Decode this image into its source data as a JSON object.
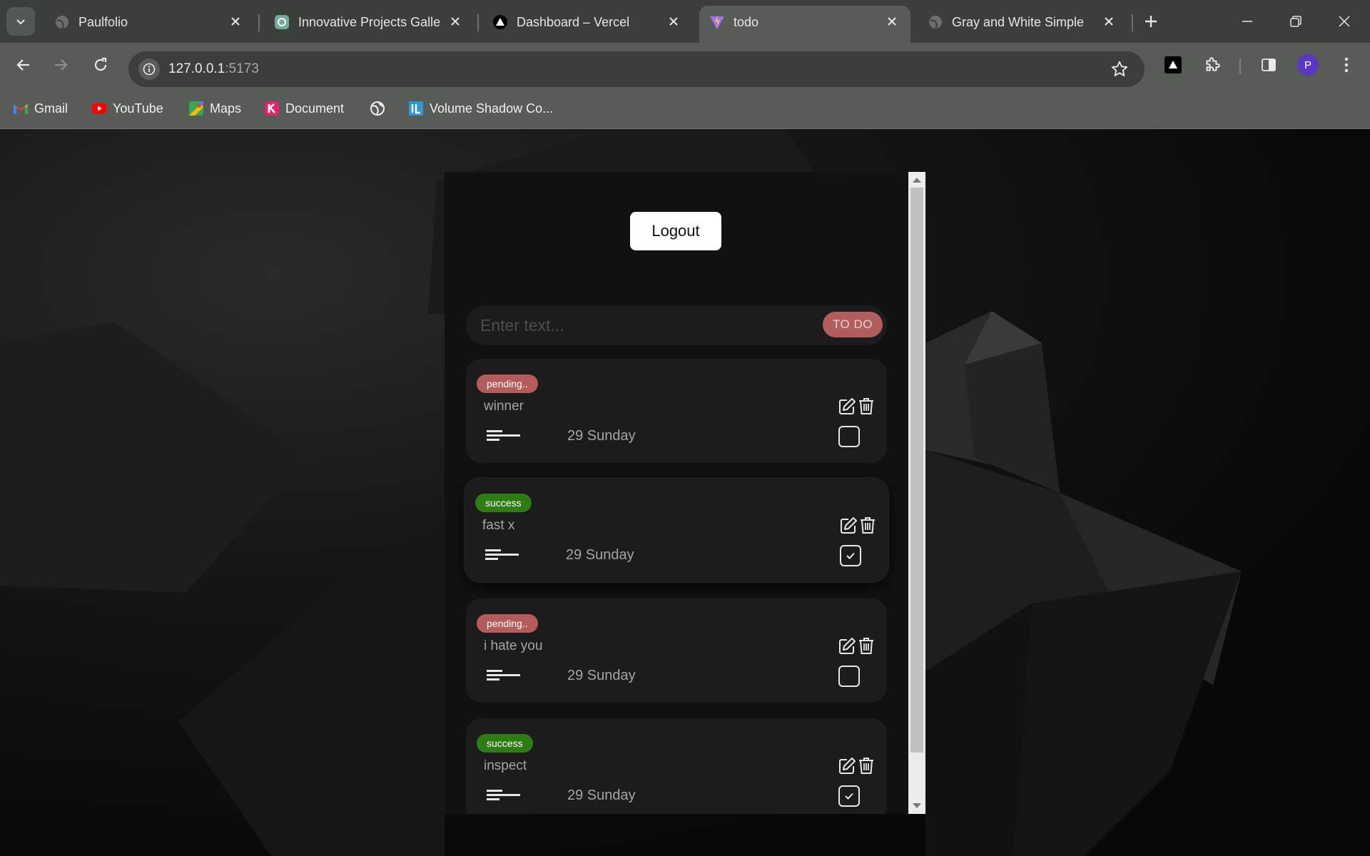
{
  "browser": {
    "tabs": [
      {
        "title": "Paulfolio",
        "icon": "globe-icon"
      },
      {
        "title": "Innovative Projects Gallery",
        "icon": "chatgpt-icon"
      },
      {
        "title": "Dashboard – Vercel",
        "icon": "vercel-icon"
      },
      {
        "title": "todo",
        "icon": "vite-icon",
        "active": true
      },
      {
        "title": "Gray and White Simple C",
        "icon": "globe-icon"
      }
    ],
    "url_host": "127.0.0.1",
    "url_port": ":5173",
    "avatar_letter": "P",
    "bookmarks": [
      {
        "label": "Gmail",
        "icon": "gmail-icon"
      },
      {
        "label": "YouTube",
        "icon": "youtube-icon"
      },
      {
        "label": "Maps",
        "icon": "maps-icon"
      },
      {
        "label": "Document",
        "icon": "document-k-icon"
      },
      {
        "label": "",
        "icon": "globe-icon"
      },
      {
        "label": "Volume Shadow Co...",
        "icon": "il-icon"
      }
    ]
  },
  "app": {
    "logout_label": "Logout",
    "input_placeholder": "Enter text...",
    "add_label": "TO DO",
    "todos": [
      {
        "status": "pending..",
        "title": "winner",
        "date": "29 Sunday",
        "done": false
      },
      {
        "status": "success",
        "title": "fast x",
        "date": "29 Sunday",
        "done": true
      },
      {
        "status": "pending..",
        "title": "i hate you",
        "date": "29 Sunday",
        "done": false
      },
      {
        "status": "success",
        "title": "inspect",
        "date": "29 Sunday",
        "done": true
      }
    ]
  },
  "colors": {
    "pending": "#b45b5c",
    "success": "#2e7d14",
    "card": "#1c1c1d",
    "chrome": "#3b3f3a"
  }
}
